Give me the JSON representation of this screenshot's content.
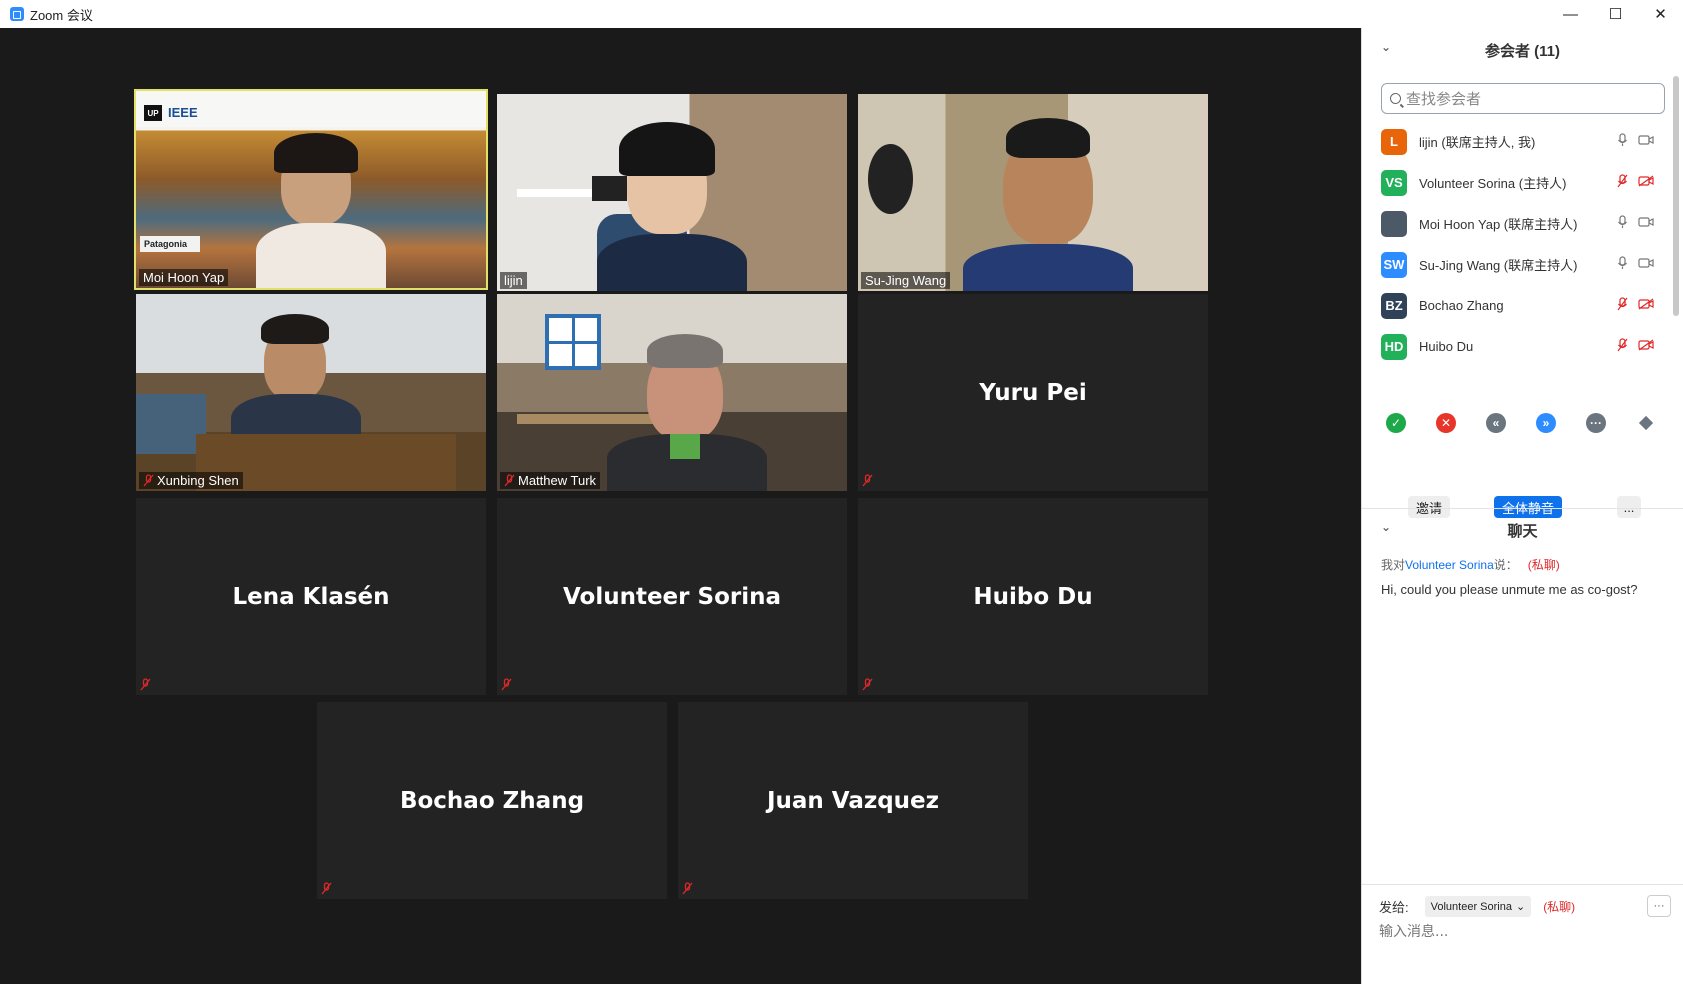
{
  "window": {
    "title": "Zoom 会议",
    "minimize": "—",
    "maximize": "☐",
    "close": "✕"
  },
  "gallery": {
    "tiles": [
      {
        "name": "Moi Hoon Yap",
        "video": true,
        "muted": false,
        "active": true,
        "overlay": "Patagonia",
        "logo_up": "UP",
        "logo_ieee": "IEEE"
      },
      {
        "name": "lijin",
        "video": true,
        "muted": false
      },
      {
        "name": "Su-Jing Wang",
        "video": true,
        "muted": false
      },
      {
        "name": "Xunbing Shen",
        "video": true,
        "muted": true
      },
      {
        "name": "Matthew Turk",
        "video": true,
        "muted": true
      },
      {
        "name": "Yuru Pei",
        "video": false,
        "muted": true
      },
      {
        "name": "Lena Klasén",
        "video": false,
        "muted": true
      },
      {
        "name": "Volunteer Sorina",
        "video": false,
        "muted": true
      },
      {
        "name": "Huibo Du",
        "video": false,
        "muted": true
      },
      {
        "name": "Bochao Zhang",
        "video": false,
        "muted": true
      },
      {
        "name": "Juan Vazquez",
        "video": false,
        "muted": true
      }
    ]
  },
  "participants": {
    "header": "参会者 (11)",
    "search_placeholder": "查找参会者",
    "list": [
      {
        "initials": "L",
        "name": "lijin (联席主持人, 我)",
        "avatar_color": "#e8650a",
        "mic_on": true,
        "cam_on": true
      },
      {
        "initials": "VS",
        "name": "Volunteer Sorina (主持人)",
        "avatar_color": "#22b05b",
        "mic_on": false,
        "cam_on": false
      },
      {
        "initials": "",
        "name": "Moi Hoon Yap (联席主持人)",
        "avatar_color": "#4b5a66",
        "mic_on": true,
        "cam_on": true
      },
      {
        "initials": "SW",
        "name": "Su-Jing Wang (联席主持人)",
        "avatar_color": "#2d8cff",
        "mic_on": true,
        "cam_on": true
      },
      {
        "initials": "BZ",
        "name": "Bochao Zhang",
        "avatar_color": "#2f4257",
        "mic_on": false,
        "cam_on": false
      },
      {
        "initials": "HD",
        "name": "Huibo Du",
        "avatar_color": "#22b05b",
        "mic_on": false,
        "cam_on": false
      }
    ],
    "reactions": [
      "yes-icon",
      "no-icon",
      "slower-icon",
      "faster-icon",
      "more-icon",
      "clear-icon"
    ],
    "invite_label": "邀请",
    "mute_all_label": "全体静音",
    "more_label": "..."
  },
  "chat": {
    "header": "聊天",
    "meta_prefix": "我对",
    "meta_recipient": "Volunteer Sorina",
    "meta_suffix": "说：",
    "meta_private": "(私聊)",
    "message": "Hi, could you please unmute me as co-gost?",
    "send_to_label": "发给:",
    "send_to_recipient": "Volunteer Sorina",
    "send_to_private": "(私聊)",
    "send_more": "···",
    "input_placeholder": "输入消息..."
  }
}
